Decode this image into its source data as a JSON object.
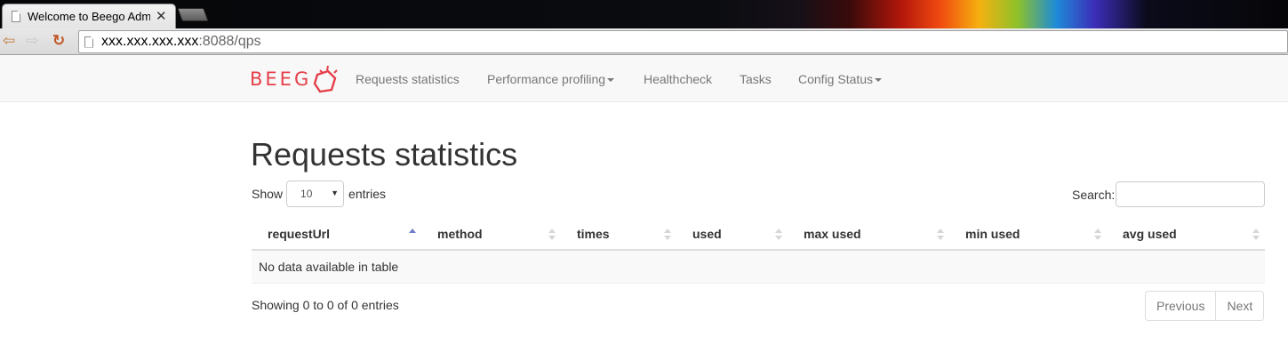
{
  "browser": {
    "tab_title": "Welcome to Beego Admin",
    "tab_close": "✕",
    "url_host": "xxx.xxx.xxx.xxx",
    "url_rest": ":8088/qps",
    "back_icon": "arrow-left",
    "forward_icon": "arrow-right",
    "reload_icon": "reload"
  },
  "navbar": {
    "brand": "BEEG",
    "items": [
      {
        "label": "Requests statistics",
        "dropdown": false
      },
      {
        "label": "Performance profiling",
        "dropdown": true
      },
      {
        "label": "Healthcheck",
        "dropdown": false
      },
      {
        "label": "Tasks",
        "dropdown": false
      },
      {
        "label": "Config Status",
        "dropdown": true
      }
    ]
  },
  "page": {
    "title": "Requests statistics",
    "length": {
      "prefix": "Show",
      "selected": "10",
      "suffix": "entries"
    },
    "search_label": "Search:",
    "table": {
      "columns": [
        "requestUrl",
        "method",
        "times",
        "used",
        "max used",
        "min used",
        "avg used"
      ],
      "sorted_column": "requestUrl",
      "sort_direction": "ascending",
      "empty_message": "No data available in table"
    },
    "info": "Showing 0 to 0 of 0 entries",
    "pagination": {
      "previous": "Previous",
      "next": "Next"
    }
  },
  "colors": {
    "brand": "#e4404a",
    "sort_active": "#6e7dc8"
  }
}
